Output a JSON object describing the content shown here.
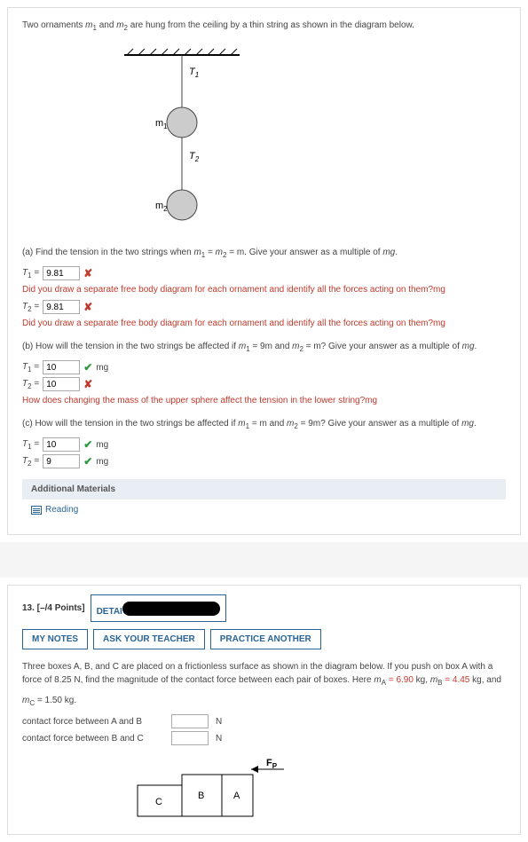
{
  "q12": {
    "intro_before": "Two ornaments ",
    "m1": "m",
    "m1_sub": "1",
    "intro_mid": " and ",
    "m2": "m",
    "m2_sub": "2",
    "intro_after": " are hung from the ceiling by a thin string as shown in the diagram below.",
    "part_a": "(a) Find the tension in the two strings when ",
    "pa_eq": " = m. Give your answer as a multiple of ",
    "mg": "mg",
    "period": ".",
    "T1_label": "T",
    "T1_sub": "1",
    "eq": " = ",
    "a_T1": "9.81",
    "a_T2": "9.81",
    "T2_label": "T",
    "T2_sub": "2",
    "fb_a1": "Did you draw a separate free body diagram for each ornament and identify all the forces acting on them?mg",
    "fb_a2": "Did you draw a separate free body diagram for each ornament and identify all the forces acting on them?mg",
    "part_b": "(b) How will the tension in the two strings be affected if ",
    "pb_m1": " = 9m and ",
    "pb_m2": " = m? Give your answer as a multiple of ",
    "b_T1": "10",
    "b_T2": "10",
    "fb_b": "How does changing the mass of the upper sphere affect the tension in the lower string?mg",
    "part_c": "(c) How will the tension in the two strings be affected if ",
    "pc_m1": " = m and ",
    "pc_m2": " = 9m? Give your answer as a multiple of ",
    "c_T1": "10",
    "c_T2": "9",
    "additional": "Additional Materials",
    "reading": "Reading"
  },
  "q13": {
    "points": "13. [–/4 Points]",
    "details": "DETAI",
    "mynotes": "MY NOTES",
    "ask": "ASK YOUR TEACHER",
    "practice": "PRACTICE ANOTHER",
    "body1": "Three boxes A, B, and C are placed on a frictionless surface as shown in the diagram below. If you push on box A with a force of 8.25 N, find the magnitude of the contact force between each pair of boxes. Here ",
    "mA_lbl": "m",
    "mA_sub": "A",
    "mA_val": " = 6.90",
    "kg": " kg, ",
    "mB_lbl": "m",
    "mB_sub": "B",
    "mB_val": " = 4.45",
    "and": " kg, and",
    "mC_lbl": "m",
    "mC_sub": "C",
    "mC_val": " = 1.50 kg.",
    "cAB": "contact force between A and B",
    "cBC": "contact force between B and C",
    "unitN": "N",
    "Fp": "F",
    "Fp_sub": "P",
    "boxA": "A",
    "boxB": "B",
    "boxC": "C"
  },
  "diagram_labels": {
    "T1": "T",
    "T1_sub": "1",
    "T2": "T",
    "T2_sub": "2",
    "m1": "m",
    "m1_sub": "1",
    "m2": "m",
    "m2_sub": "2"
  }
}
